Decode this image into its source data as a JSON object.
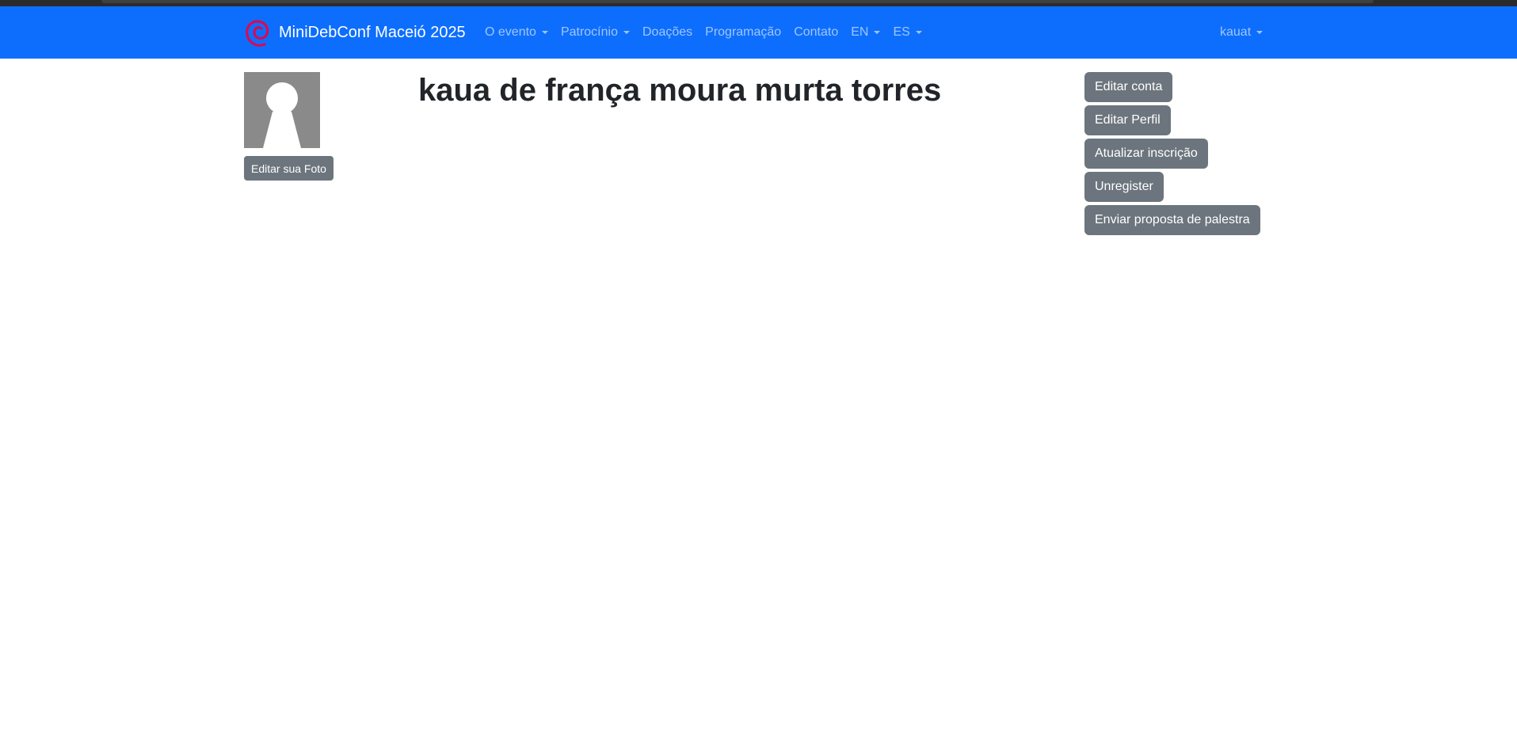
{
  "navbar": {
    "brand": "MiniDebConf Maceió 2025",
    "brand_logo_icon": "debian-swirl-icon",
    "background_color": "#0d6efd",
    "items": [
      {
        "label": "O evento",
        "dropdown": true
      },
      {
        "label": "Patrocínio",
        "dropdown": true
      },
      {
        "label": "Doações",
        "dropdown": false
      },
      {
        "label": "Programação",
        "dropdown": false
      },
      {
        "label": "Contato",
        "dropdown": false
      },
      {
        "label": "EN",
        "dropdown": true
      },
      {
        "label": "ES",
        "dropdown": true
      }
    ],
    "user": {
      "label": "kauat",
      "dropdown": true
    }
  },
  "profile": {
    "avatar_icon": "default-avatar-icon",
    "edit_photo_label": "Editar sua Foto",
    "name": "kaua de frança moura murta torres"
  },
  "actions": {
    "button_color": "#6c757d",
    "buttons": [
      "Editar conta",
      "Editar Perfil",
      "Atualizar inscrição",
      "Unregister",
      "Enviar proposta de palestra"
    ]
  }
}
